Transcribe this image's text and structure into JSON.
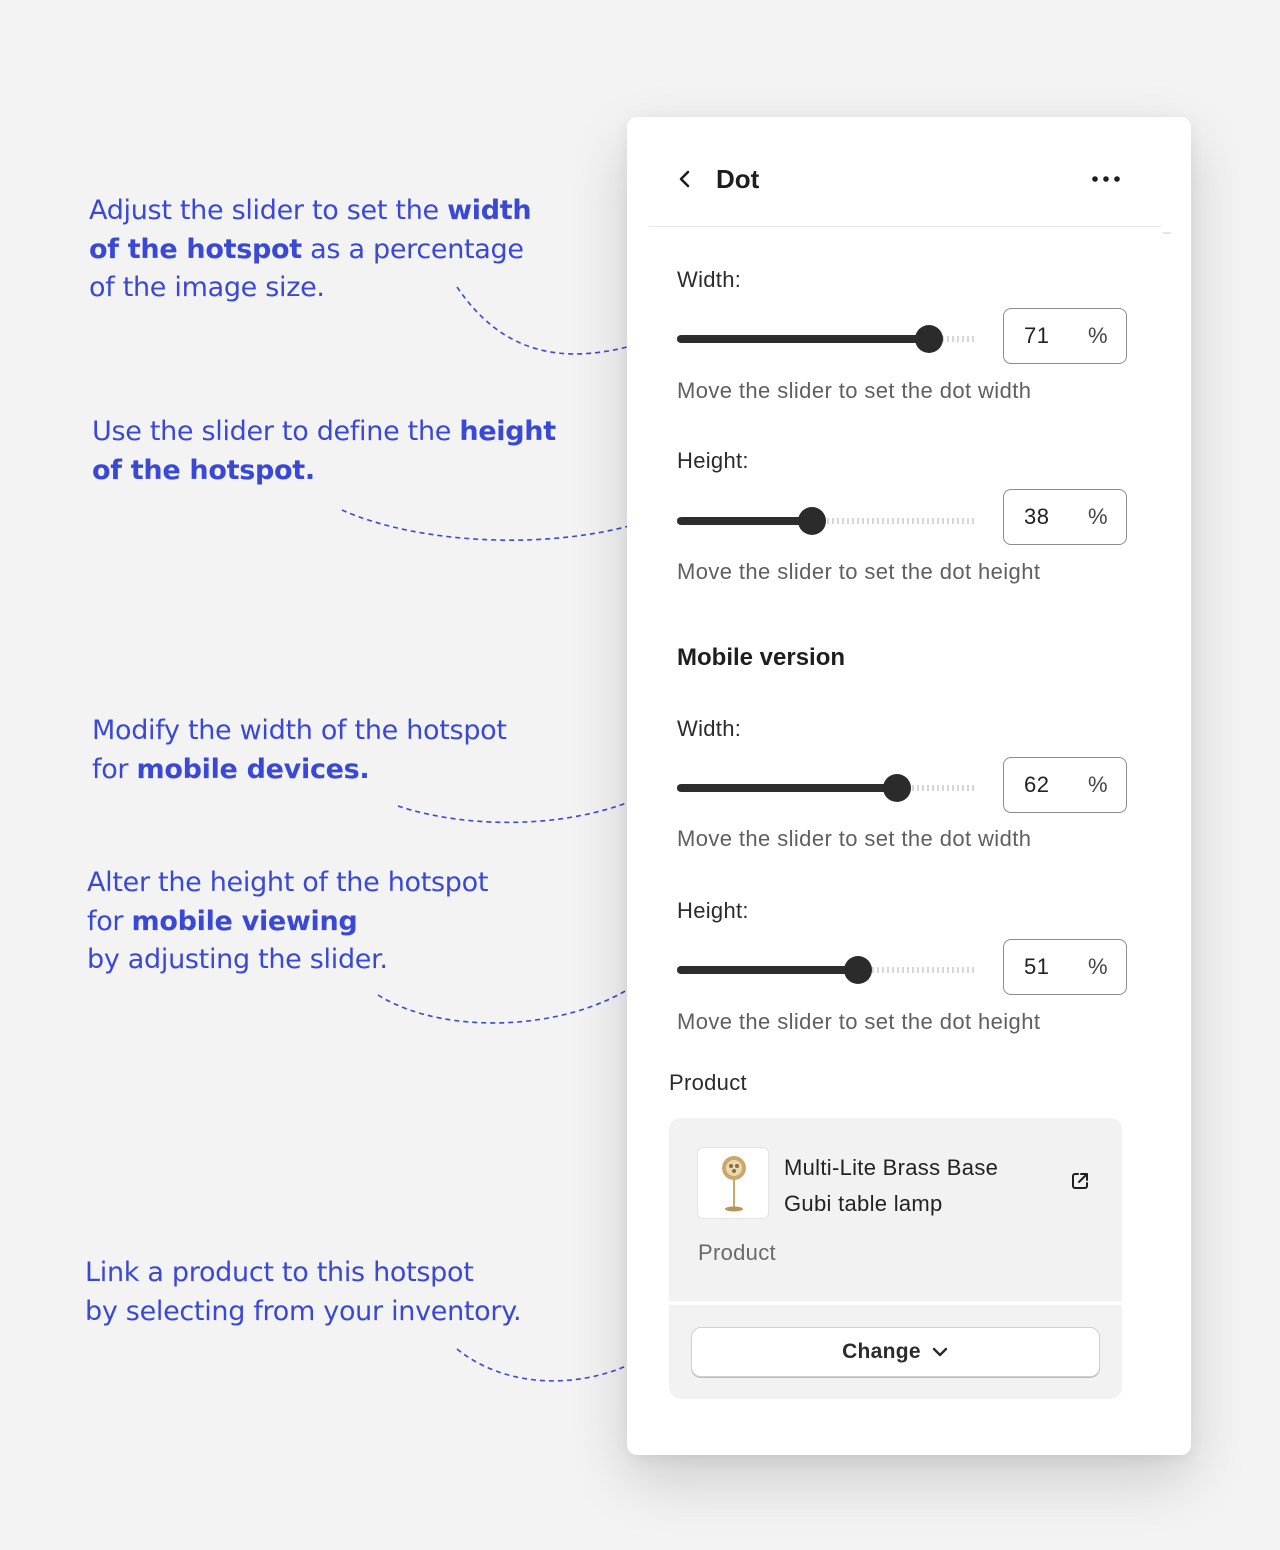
{
  "annotations": [
    {
      "parts": [
        {
          "text": "Adjust the slider to set the "
        },
        {
          "text": "width",
          "bold": true
        },
        {
          "text": "\n"
        },
        {
          "text": "of the hotspot",
          "bold": true
        },
        {
          "text": " as a percentage\nof the image size."
        }
      ]
    },
    {
      "parts": [
        {
          "text": "Use the slider to define the "
        },
        {
          "text": "height",
          "bold": true
        },
        {
          "text": "\n"
        },
        {
          "text": "of the hotspot.",
          "bold": true
        }
      ]
    },
    {
      "parts": [
        {
          "text": "Modify the width of the hotspot\nfor "
        },
        {
          "text": "mobile devices.",
          "bold": true
        }
      ]
    },
    {
      "parts": [
        {
          "text": "Alter the height of the hotspot\nfor "
        },
        {
          "text": "mobile viewing",
          "bold": true
        },
        {
          "text": "\nby adjusting the slider."
        }
      ]
    },
    {
      "parts": [
        {
          "text": "Link a product to this hotspot\nby selecting from your inventory."
        }
      ]
    }
  ],
  "accent_color": "#3a48d6",
  "panel": {
    "title": "Dot",
    "back_icon": "chevron-left-icon",
    "more_icon": "more-horizontal-icon",
    "desktop": {
      "width": {
        "label": "Width:",
        "value": 71,
        "unit": "%",
        "help": "Move the slider to set the dot width"
      },
      "height": {
        "label": "Height:",
        "value": 38,
        "unit": "%",
        "help": "Move the slider to set the dot height"
      }
    },
    "mobile": {
      "title": "Mobile version",
      "width": {
        "label": "Width:",
        "value": 62,
        "unit": "%",
        "help": "Move the slider to set the dot width"
      },
      "height": {
        "label": "Height:",
        "value": 51,
        "unit": "%",
        "help": "Move the slider to set the dot height"
      }
    },
    "product": {
      "label": "Product",
      "name_line1": "Multi-Lite Brass Base",
      "name_line2": "Gubi table lamp",
      "type": "Product",
      "link_icon": "external-link-icon",
      "change_label": "Change",
      "change_icon": "chevron-down-icon"
    }
  }
}
